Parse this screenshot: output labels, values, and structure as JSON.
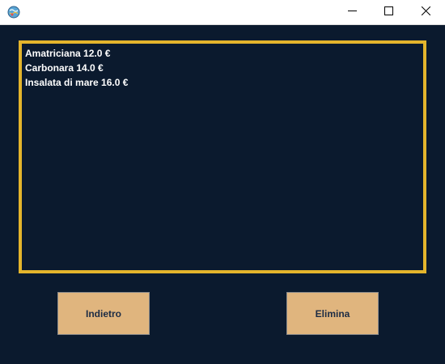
{
  "titlebar": {
    "icon": "app-globe-icon",
    "controls": [
      "minimize-icon",
      "maximize-icon",
      "close-icon"
    ]
  },
  "list": {
    "items": [
      "Amatriciana 12.0 €",
      "Carbonara 14.0 €",
      "Insalata di mare 16.0 €"
    ],
    "border_color": "#e4b52c"
  },
  "buttons": {
    "back_label": "Indietro",
    "delete_label": "Elimina",
    "button_color": "#e0b57e"
  },
  "colors": {
    "background": "#0b1a2e",
    "text": "#ffffff"
  }
}
